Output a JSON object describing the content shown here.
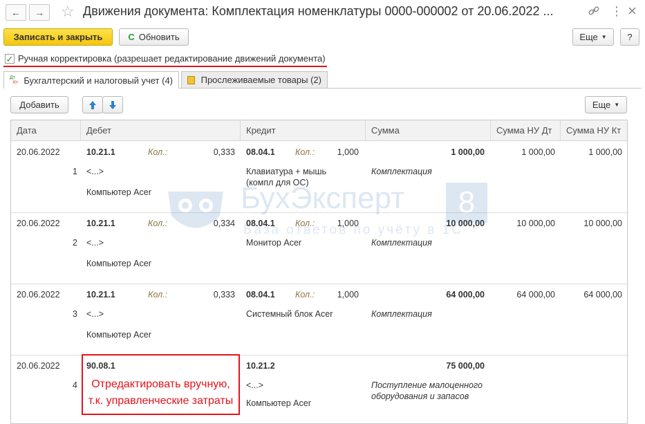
{
  "window": {
    "title": "Движения документа: Комплектация номенклатуры 0000-000002 от 20.06.2022 ...",
    "back_glyph": "←",
    "forward_glyph": "→",
    "star_glyph": "☆",
    "link_glyph": "🔗",
    "menu_glyph": "⋮",
    "close_glyph": "×"
  },
  "toolbar": {
    "save_close": "Записать и закрыть",
    "refresh": "Обновить",
    "refresh_icon": "C",
    "more": "Еще",
    "help": "?"
  },
  "manual_edit": {
    "checked": true,
    "label": "Ручная корректировка (разрешает редактирование движений документа)"
  },
  "tabs": [
    {
      "label": "Бухгалтерский и налоговый учет (4)",
      "icon_top": "Дт",
      "icon_bottom": "Кт",
      "active": true
    },
    {
      "label": "Прослеживаемые товары (2)",
      "active": false
    }
  ],
  "table_toolbar": {
    "add": "Добавить",
    "more": "Еще"
  },
  "columns": [
    "Дата",
    "Дебет",
    "Кредит",
    "Сумма",
    "Сумма НУ Дт",
    "Сумма НУ Кт"
  ],
  "kol_label": "Кол.:",
  "rows": [
    {
      "date": "20.06.2022",
      "num": "1",
      "debit_account": "10.21.1",
      "debit_qty": "0,333",
      "debit_sub1": "<...>",
      "debit_sub2": "Компьютер Acer",
      "credit_account": "08.04.1",
      "credit_qty": "1,000",
      "credit_sub1": "Клавиатура + мышь",
      "credit_sub2": "(компл для ОС)",
      "sum": "1 000,00",
      "content": "Комплектация",
      "content2": "",
      "nu_dt": "1 000,00",
      "nu_kt": "1 000,00"
    },
    {
      "date": "20.06.2022",
      "num": "2",
      "debit_account": "10.21.1",
      "debit_qty": "0,334",
      "debit_sub1": "<...>",
      "debit_sub2": "Компьютер Acer",
      "credit_account": "08.04.1",
      "credit_qty": "1,000",
      "credit_sub1": "Монитор Acer",
      "credit_sub2": "",
      "sum": "10 000,00",
      "content": "Комплектация",
      "content2": "",
      "nu_dt": "10 000,00",
      "nu_kt": "10 000,00"
    },
    {
      "date": "20.06.2022",
      "num": "3",
      "debit_account": "10.21.1",
      "debit_qty": "0,333",
      "debit_sub1": "<...>",
      "debit_sub2": "Компьютер Acer",
      "credit_account": "08.04.1",
      "credit_qty": "1,000",
      "credit_sub1": "Системный блок Acer",
      "credit_sub2": "",
      "sum": "64 000,00",
      "content": "Комплектация",
      "content2": "",
      "nu_dt": "64 000,00",
      "nu_kt": "64 000,00"
    },
    {
      "date": "20.06.2022",
      "num": "4",
      "debit_account": "90.08.1",
      "debit_qty": "",
      "debit_sub1": "",
      "debit_sub2": "",
      "credit_account": "10.21.2",
      "credit_qty": "",
      "credit_sub1": "<...>",
      "credit_sub2": "Компьютер Acer",
      "sum": "75 000,00",
      "content": "Поступление малоценного",
      "content2": "оборудования и запасов",
      "nu_dt": "",
      "nu_kt": ""
    }
  ],
  "annotation": {
    "line1": "Отредактировать вручную,",
    "line2": "т.к. управленческие затраты",
    "color": "#e3131b"
  },
  "watermark": {
    "brand": "БухЭксперт",
    "digit": "8",
    "tagline": "База ответов по учёту в 1С"
  },
  "colors": {
    "accent_yellow": "#f5c60f",
    "arrow_blue": "#2d7fd3",
    "check_green": "#1c9d2c",
    "annotation_red": "#e3131b"
  }
}
